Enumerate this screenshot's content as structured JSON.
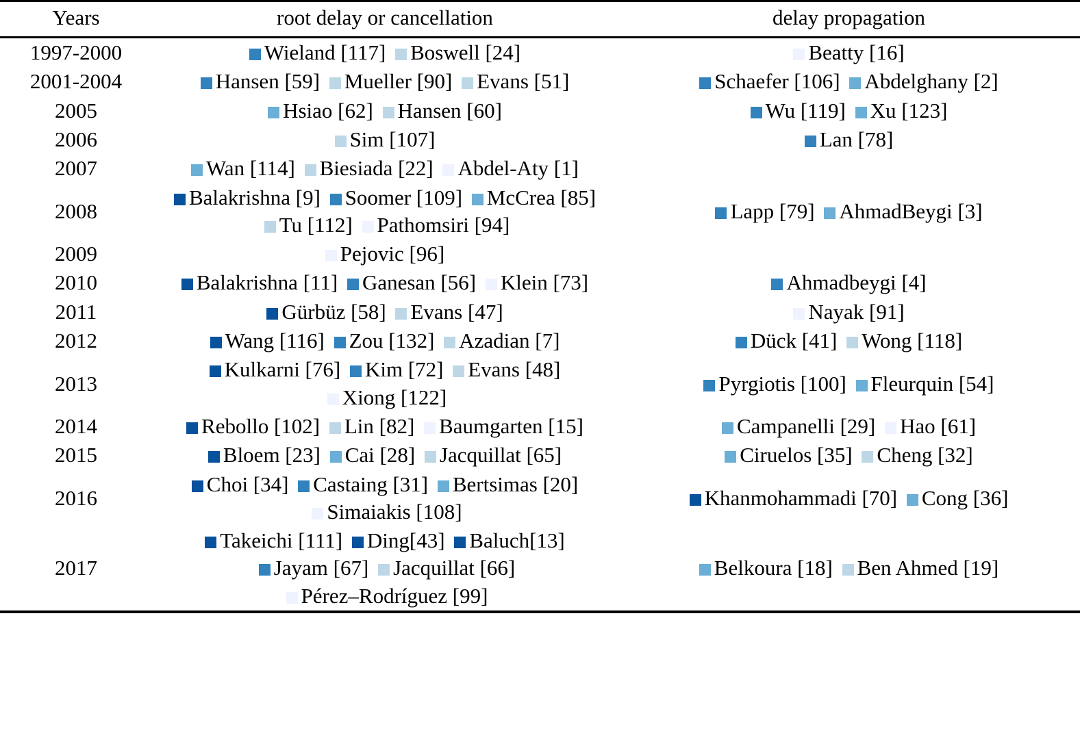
{
  "table": {
    "columns": [
      "Years",
      "root delay or cancellation",
      "delay propagation"
    ],
    "palette": {
      "shade1": "#08519c",
      "shade2": "#3182bd",
      "shade3": "#6baed6",
      "shade4": "#bdd7e7",
      "shade5": "#eff3ff"
    },
    "rows": [
      {
        "years": "1997-2000",
        "root": [
          {
            "label": "Wieland [117]",
            "shade": "s2"
          },
          {
            "label": "Boswell [24]",
            "shade": "s4"
          }
        ],
        "prop": [
          {
            "label": "Beatty [16]",
            "shade": "s5"
          }
        ]
      },
      {
        "years": "2001-2004",
        "root": [
          {
            "label": "Hansen [59]",
            "shade": "s2"
          },
          {
            "label": "Mueller [90]",
            "shade": "s4"
          },
          {
            "label": "Evans [51]",
            "shade": "s4"
          }
        ],
        "prop": [
          {
            "label": "Schaefer [106]",
            "shade": "s2"
          },
          {
            "label": "Abdelghany [2]",
            "shade": "s3"
          }
        ]
      },
      {
        "years": "2005",
        "root": [
          {
            "label": "Hsiao [62]",
            "shade": "s3"
          },
          {
            "label": "Hansen [60]",
            "shade": "s4"
          }
        ],
        "prop": [
          {
            "label": "Wu [119]",
            "shade": "s2"
          },
          {
            "label": "Xu [123]",
            "shade": "s3"
          }
        ]
      },
      {
        "years": "2006",
        "root": [
          {
            "label": "Sim [107]",
            "shade": "s4"
          }
        ],
        "prop": [
          {
            "label": "Lan [78]",
            "shade": "s2"
          }
        ]
      },
      {
        "years": "2007",
        "root": [
          {
            "label": "Wan [114]",
            "shade": "s3"
          },
          {
            "label": "Biesiada [22]",
            "shade": "s4"
          },
          {
            "label": "Abdel-Aty [1]",
            "shade": "s5"
          }
        ],
        "prop": []
      },
      {
        "years": "2008",
        "root": [
          {
            "label": "Balakrishna [9]",
            "shade": "s1"
          },
          {
            "label": "Soomer [109]",
            "shade": "s2"
          },
          {
            "label": "McCrea [85]",
            "shade": "s3"
          },
          {
            "label": "Tu [112]",
            "shade": "s4"
          },
          {
            "label": "Pathomsiri [94]",
            "shade": "s5"
          }
        ],
        "prop": [
          {
            "label": "Lapp [79]",
            "shade": "s2"
          },
          {
            "label": "AhmadBeygi [3]",
            "shade": "s3"
          }
        ]
      },
      {
        "years": "2009",
        "root": [
          {
            "label": "Pejovic [96]",
            "shade": "s5"
          }
        ],
        "prop": []
      },
      {
        "years": "2010",
        "root": [
          {
            "label": "Balakrishna [11]",
            "shade": "s1"
          },
          {
            "label": "Ganesan [56]",
            "shade": "s2"
          },
          {
            "label": "Klein [73]",
            "shade": "s5"
          }
        ],
        "prop": [
          {
            "label": "Ahmadbeygi [4]",
            "shade": "s2"
          }
        ]
      },
      {
        "years": "2011",
        "root": [
          {
            "label": "Gürbüz [58]",
            "shade": "s1"
          },
          {
            "label": "Evans [47]",
            "shade": "s4"
          }
        ],
        "prop": [
          {
            "label": "Nayak [91]",
            "shade": "s5"
          }
        ]
      },
      {
        "years": "2012",
        "root": [
          {
            "label": "Wang [116]",
            "shade": "s1"
          },
          {
            "label": "Zou [132]",
            "shade": "s2"
          },
          {
            "label": "Azadian [7]",
            "shade": "s4"
          }
        ],
        "prop": [
          {
            "label": "Dück [41]",
            "shade": "s2"
          },
          {
            "label": "Wong [118]",
            "shade": "s4"
          }
        ]
      },
      {
        "years": "2013",
        "root": [
          {
            "label": "Kulkarni [76]",
            "shade": "s1"
          },
          {
            "label": "Kim [72]",
            "shade": "s2"
          },
          {
            "label": "Evans [48]",
            "shade": "s4"
          },
          {
            "label": "Xiong [122]",
            "shade": "s5"
          }
        ],
        "prop": [
          {
            "label": "Pyrgiotis [100]",
            "shade": "s2"
          },
          {
            "label": "Fleurquin [54]",
            "shade": "s3"
          }
        ]
      },
      {
        "years": "2014",
        "root": [
          {
            "label": "Rebollo [102]",
            "shade": "s1"
          },
          {
            "label": "Lin [82]",
            "shade": "s4"
          },
          {
            "label": "Baumgarten [15]",
            "shade": "s5"
          }
        ],
        "prop": [
          {
            "label": "Campanelli [29]",
            "shade": "s3"
          },
          {
            "label": "Hao [61]",
            "shade": "s5"
          }
        ]
      },
      {
        "years": "2015",
        "root": [
          {
            "label": "Bloem [23]",
            "shade": "s1"
          },
          {
            "label": "Cai [28]",
            "shade": "s3"
          },
          {
            "label": "Jacquillat [65]",
            "shade": "s4"
          }
        ],
        "prop": [
          {
            "label": "Ciruelos [35]",
            "shade": "s3"
          },
          {
            "label": "Cheng [32]",
            "shade": "s4"
          }
        ]
      },
      {
        "years": "2016",
        "root": [
          {
            "label": "Choi [34]",
            "shade": "s1"
          },
          {
            "label": "Castaing [31]",
            "shade": "s2"
          },
          {
            "label": "Bertsimas [20]",
            "shade": "s3"
          },
          {
            "label": "Simaiakis [108]",
            "shade": "s5"
          }
        ],
        "prop": [
          {
            "label": "Khanmohammadi [70]",
            "shade": "s1"
          },
          {
            "label": "Cong [36]",
            "shade": "s3"
          }
        ]
      },
      {
        "years": "2017",
        "root": [
          {
            "label": "Takeichi [111]",
            "shade": "s1"
          },
          {
            "label": "Ding[43]",
            "shade": "s1"
          },
          {
            "label": "Baluch[13]",
            "shade": "s1"
          },
          {
            "label": "Jayam [67]",
            "shade": "s2"
          },
          {
            "label": "Jacquillat [66]",
            "shade": "s4"
          },
          {
            "label": "Pérez–Rodríguez [99]",
            "shade": "s5"
          }
        ],
        "prop": [
          {
            "label": "Belkoura [18]",
            "shade": "s3"
          },
          {
            "label": "Ben Ahmed [19]",
            "shade": "s4"
          }
        ]
      }
    ]
  }
}
